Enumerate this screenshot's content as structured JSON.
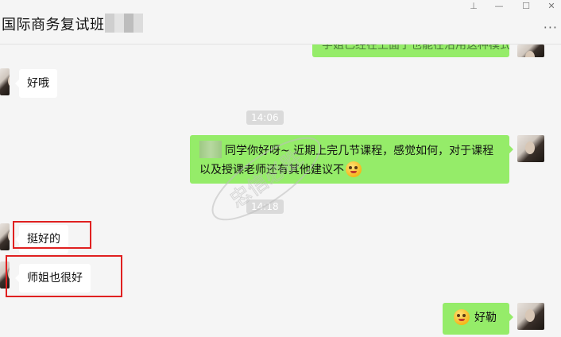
{
  "window": {
    "title": "国际商务复试班"
  },
  "window_controls": {
    "pin": "⊥",
    "minimize": "—",
    "maximize": "☐",
    "close": "✕"
  },
  "header": {
    "more": "···"
  },
  "messages": {
    "top_partial": "学姐已经在上面了也能在沿用这种模式",
    "m1": "好哦",
    "t1": "14:06",
    "m2": "同学你好呀~ 近期上完几节课程，感觉如何，对于课程以及授课老师还有其他建议不",
    "t2": "14:18",
    "m3": "挺好的",
    "m4": "师姐也很好",
    "m5": "好勒"
  },
  "watermark": {
    "text": "忠信必胜"
  },
  "colors": {
    "bubble_self": "#95ec69",
    "bubble_other": "#ffffff",
    "highlight": "#e02020"
  }
}
